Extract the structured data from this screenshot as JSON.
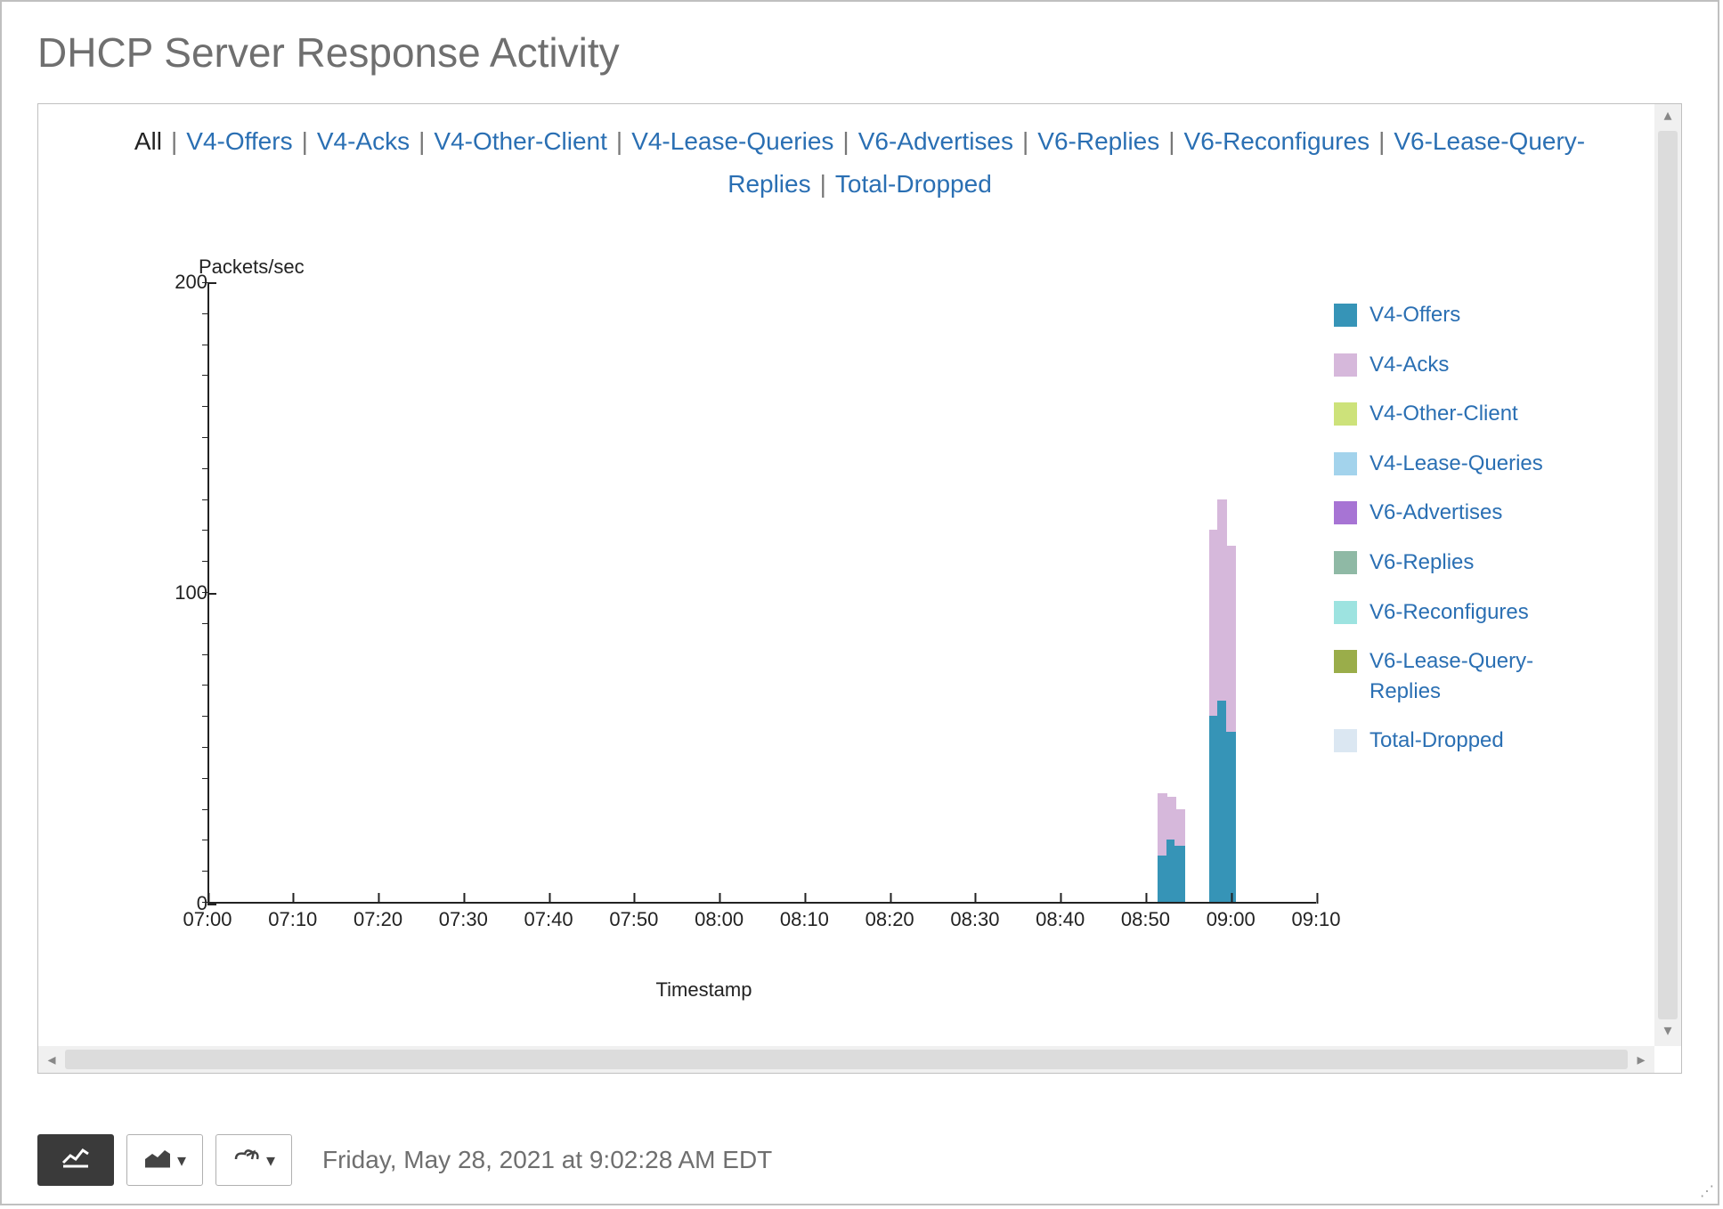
{
  "title": "DHCP Server Response Activity",
  "filters": {
    "items": [
      "All",
      "V4-Offers",
      "V4-Acks",
      "V4-Other-Client",
      "V4-Lease-Queries",
      "V6-Advertises",
      "V6-Replies",
      "V6-Reconfigures",
      "V6-Lease-Query-Replies",
      "Total-Dropped"
    ],
    "selected": "All"
  },
  "chart_data": {
    "type": "area",
    "title": "",
    "xlabel": "Timestamp",
    "ylabel": "Packets/sec",
    "ylim": [
      0,
      200
    ],
    "yticks_major": [
      0,
      100,
      200
    ],
    "x_ticks": [
      "07:00",
      "07:10",
      "07:20",
      "07:30",
      "07:40",
      "07:50",
      "08:00",
      "08:10",
      "08:20",
      "08:30",
      "08:40",
      "08:50",
      "09:00",
      "09:10"
    ],
    "series": [
      {
        "name": "V4-Offers",
        "color": "#3694b7"
      },
      {
        "name": "V4-Acks",
        "color": "#d6b8db"
      },
      {
        "name": "V4-Other-Client",
        "color": "#cde27a"
      },
      {
        "name": "V4-Lease-Queries",
        "color": "#a3d3ec"
      },
      {
        "name": "V6-Advertises",
        "color": "#a774d4"
      },
      {
        "name": "V6-Replies",
        "color": "#8fb9a5"
      },
      {
        "name": "V6-Reconfigures",
        "color": "#9de3e0"
      },
      {
        "name": "V6-Lease-Query-Replies",
        "color": "#9aad4a"
      },
      {
        "name": "Total-Dropped",
        "color": "#dbe7f2"
      }
    ],
    "stacked_columns": [
      {
        "x": "08:52",
        "segments": [
          {
            "series": "V4-Offers",
            "value": 15
          },
          {
            "series": "V4-Acks",
            "value": 20
          }
        ]
      },
      {
        "x": "08:53",
        "segments": [
          {
            "series": "V4-Offers",
            "value": 20
          },
          {
            "series": "V4-Acks",
            "value": 14
          }
        ]
      },
      {
        "x": "08:54",
        "segments": [
          {
            "series": "V4-Offers",
            "value": 18
          },
          {
            "series": "V4-Acks",
            "value": 12
          }
        ]
      },
      {
        "x": "08:58",
        "segments": [
          {
            "series": "V4-Offers",
            "value": 60
          },
          {
            "series": "V4-Acks",
            "value": 60
          }
        ]
      },
      {
        "x": "08:59",
        "segments": [
          {
            "series": "V4-Offers",
            "value": 65
          },
          {
            "series": "V4-Acks",
            "value": 65
          }
        ]
      },
      {
        "x": "09:00",
        "segments": [
          {
            "series": "V4-Offers",
            "value": 55
          },
          {
            "series": "V4-Acks",
            "value": 60
          }
        ]
      }
    ]
  },
  "toolbar": {
    "buttons": [
      {
        "id": "line-chart",
        "active": true
      },
      {
        "id": "area-chart",
        "active": false,
        "dropdown": true
      },
      {
        "id": "export",
        "active": false,
        "dropdown": true
      }
    ],
    "timestamp": "Friday, May 28, 2021 at 9:02:28 AM EDT"
  },
  "glyphs": {
    "caret_down": "▾",
    "arrow_up": "▴",
    "arrow_down": "▾",
    "arrow_left": "◂",
    "arrow_right": "▸",
    "resize": "⋰"
  }
}
